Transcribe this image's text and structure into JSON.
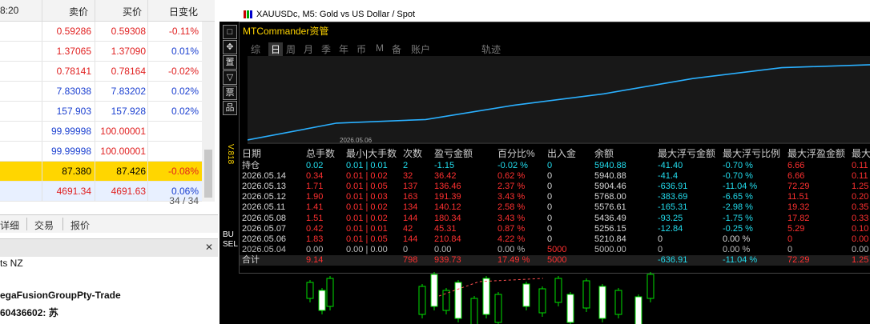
{
  "market_watch": {
    "time_fragment": "8:20",
    "headers": {
      "sell": "卖价",
      "buy": "买价",
      "change": "日变化"
    },
    "rows": [
      {
        "sell": "0.59286",
        "buy": "0.59308",
        "change": "-0.11%",
        "sell_color": "red",
        "buy_color": "red",
        "change_color": "red",
        "bg": "alt"
      },
      {
        "sell": "1.37065",
        "buy": "1.37090",
        "change": "0.01%",
        "sell_color": "red",
        "buy_color": "red",
        "change_color": "blue",
        "bg": "alt"
      },
      {
        "sell": "0.78141",
        "buy": "0.78164",
        "change": "-0.02%",
        "sell_color": "red",
        "buy_color": "red",
        "change_color": "red",
        "bg": "alt"
      },
      {
        "sell": "7.83038",
        "buy": "7.83202",
        "change": "0.02%",
        "sell_color": "blue",
        "buy_color": "blue",
        "change_color": "blue",
        "bg": "none"
      },
      {
        "sell": "157.903",
        "buy": "157.928",
        "change": "0.02%",
        "sell_color": "blue",
        "buy_color": "blue",
        "change_color": "blue",
        "bg": "none"
      },
      {
        "sell": "99.99998",
        "buy": "100.00001",
        "change": "",
        "sell_color": "blue",
        "buy_color": "red",
        "change_color": "blue",
        "bg": "none"
      },
      {
        "sell": "99.99998",
        "buy": "100.00001",
        "change": "",
        "sell_color": "blue",
        "buy_color": "red",
        "change_color": "blue",
        "bg": "none"
      },
      {
        "sell": "87.380",
        "buy": "87.426",
        "change": "-0.08%",
        "sell_color": "dark",
        "buy_color": "dark",
        "change_color": "red",
        "bg": "highlight"
      },
      {
        "sell": "4691.34",
        "buy": "4691.63",
        "change": "0.06%",
        "sell_color": "red",
        "buy_color": "red",
        "change_color": "blue",
        "bg": "lightblue"
      }
    ],
    "count": "34 / 34",
    "tabs": {
      "detail": "详细",
      "trade": "交易",
      "report": "报价"
    }
  },
  "navigator": {
    "line1": "ts NZ",
    "line2": "egaFusionGroupPty-Trade",
    "line3": "60436602: 苏"
  },
  "chart": {
    "title": "XAUUSDc, M5:  Gold vs US Dollar / Spot",
    "tools": [
      "□",
      "✥",
      "置",
      "▽",
      "票",
      "品"
    ],
    "side_label": "V.818",
    "side_bu": [
      "BU",
      "SEL"
    ],
    "panel_title": "MTCommander资管",
    "tabs": [
      "综",
      "日",
      "周",
      "月",
      "季",
      "年",
      "币",
      "M",
      "备",
      "账户",
      "轨迹"
    ],
    "active_tab": 1,
    "equity_date_label": "2026.05.06",
    "colors": {
      "equity_line": "#2ab0ff",
      "accent": "#ffd400"
    }
  },
  "table": {
    "headers": [
      "日期",
      "总手数",
      "最小|大手数",
      "次数",
      "盈亏金额",
      "百分比%",
      "出入金",
      "余额",
      "最大浮亏金额",
      "最大浮亏比例",
      "最大浮盈金额",
      "最大"
    ],
    "rows": [
      {
        "cells": [
          "持仓",
          "0.02",
          "0.01 | 0.01",
          "2",
          "-1.15",
          "-0.02 %",
          "0",
          "5940.88",
          "-41.40",
          "-0.70 %",
          "6.66",
          "0.11"
        ],
        "style": "hold"
      },
      {
        "cells": [
          "2026.05.14",
          "0.34",
          "0.01 | 0.02",
          "32",
          "36.42",
          "0.62 %",
          "0",
          "5940.88",
          "-41.4",
          "-0.70 %",
          "6.66",
          "0.11"
        ],
        "style": "profit"
      },
      {
        "cells": [
          "2026.05.13",
          "1.71",
          "0.01 | 0.05",
          "137",
          "136.46",
          "2.37 %",
          "0",
          "5904.46",
          "-636.91",
          "-11.04 %",
          "72.29",
          "1.25"
        ],
        "style": "profit"
      },
      {
        "cells": [
          "2026.05.12",
          "1.90",
          "0.01 | 0.03",
          "163",
          "191.39",
          "3.43 %",
          "0",
          "5768.00",
          "-383.69",
          "-6.65 %",
          "11.51",
          "0.20"
        ],
        "style": "profit"
      },
      {
        "cells": [
          "2026.05.11",
          "1.41",
          "0.01 | 0.02",
          "134",
          "140.12",
          "2.58 %",
          "0",
          "5576.61",
          "-165.31",
          "-2.98 %",
          "19.32",
          "0.35"
        ],
        "style": "profit"
      },
      {
        "cells": [
          "2026.05.08",
          "1.51",
          "0.01 | 0.02",
          "144",
          "180.34",
          "3.43 %",
          "0",
          "5436.49",
          "-93.25",
          "-1.75 %",
          "17.82",
          "0.33"
        ],
        "style": "profit"
      },
      {
        "cells": [
          "2026.05.07",
          "0.42",
          "0.01 | 0.01",
          "42",
          "45.31",
          "0.87 %",
          "0",
          "5256.15",
          "-12.84",
          "-0.25 %",
          "5.29",
          "0.10"
        ],
        "style": "profit"
      },
      {
        "cells": [
          "2026.05.06",
          "1.83",
          "0.01 | 0.05",
          "144",
          "210.84",
          "4.22 %",
          "0",
          "5210.84",
          "0",
          "0.00 %",
          "0",
          "0.00"
        ],
        "style": "profit"
      },
      {
        "cells": [
          "2026.05.04",
          "0.00",
          "0.00 | 0.00",
          "0",
          "0.00",
          "0.00 %",
          "5000",
          "5000.00",
          "0",
          "0.00 %",
          "0",
          "0.00"
        ],
        "style": "zero"
      },
      {
        "cells": [
          "合计",
          "9.14",
          "",
          "798",
          "939.73",
          "17.49 %",
          "5000",
          "",
          "-636.91",
          "-11.04 %",
          "72.29",
          "1.25"
        ],
        "style": "total"
      }
    ]
  }
}
